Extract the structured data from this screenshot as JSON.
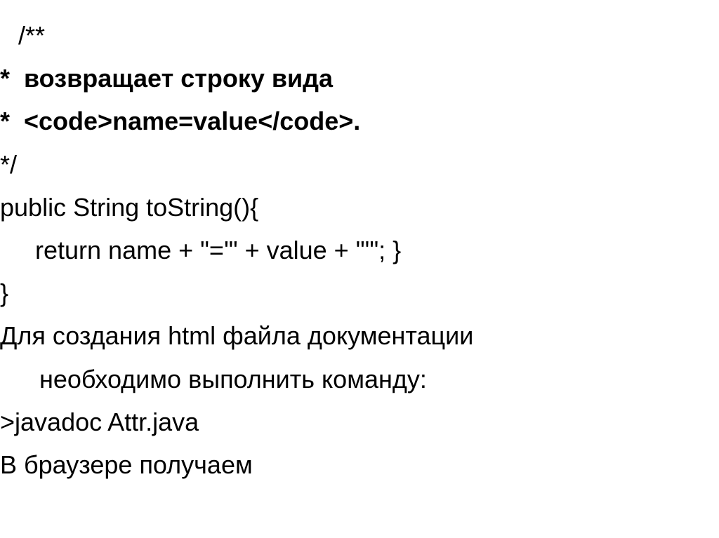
{
  "lines": {
    "l1": " /**",
    "l2": "*  возвращает строку вида",
    "l3": "*  <code>name=value</code>.",
    "l4": "*/",
    "l5": "public String toString(){",
    "l6": "     return name + \"='\" + value + \"'\"; }",
    "l7": "}",
    "l8a": "Для создания html файла документации",
    "l8b": "необходимо выполнить команду:",
    "l9": ">javadoc Attr.java",
    "l10": "В браузере получаем"
  }
}
